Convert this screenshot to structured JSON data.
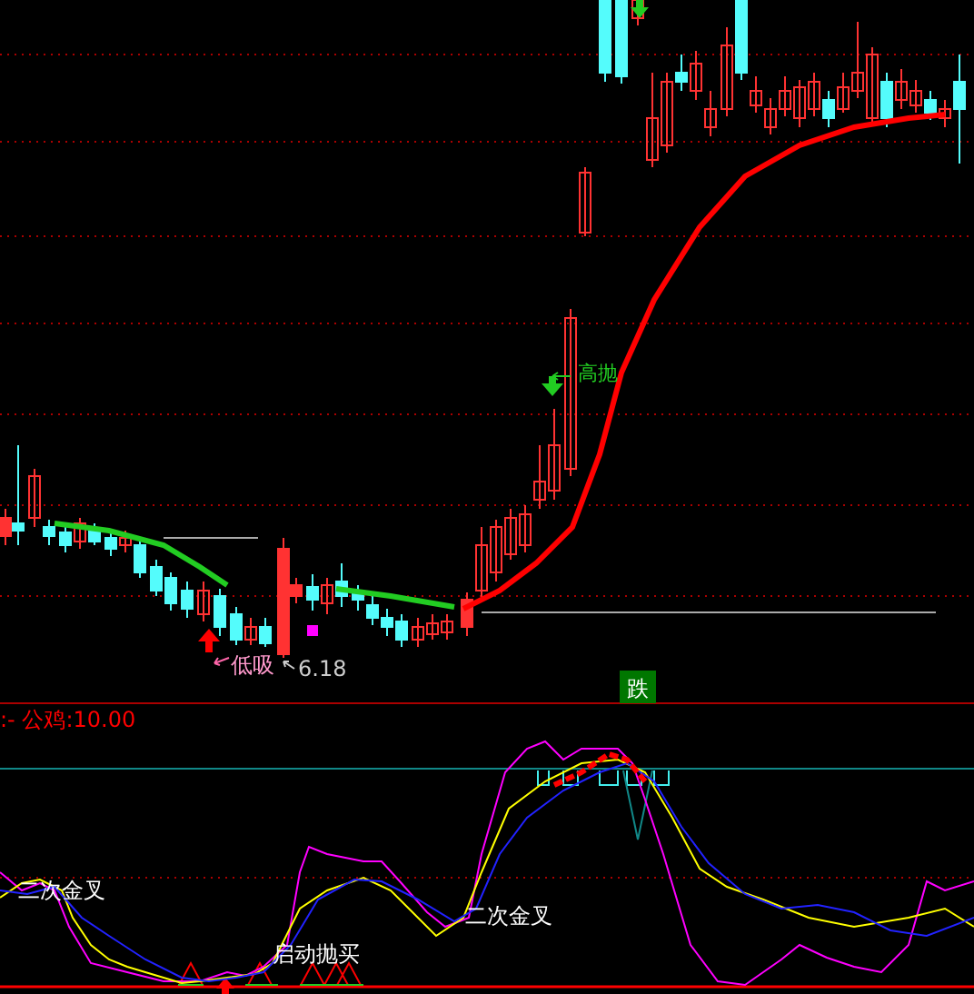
{
  "price_panel": {
    "buy_signal": "低吸",
    "low_price": "6.18",
    "sell_signal": "高抛",
    "trend_badge": "跌"
  },
  "indicator_panel": {
    "title": ":- 公鸡:10.00",
    "signals": [
      "二次金叉",
      "二次金叉",
      "启动抛买"
    ]
  }
}
